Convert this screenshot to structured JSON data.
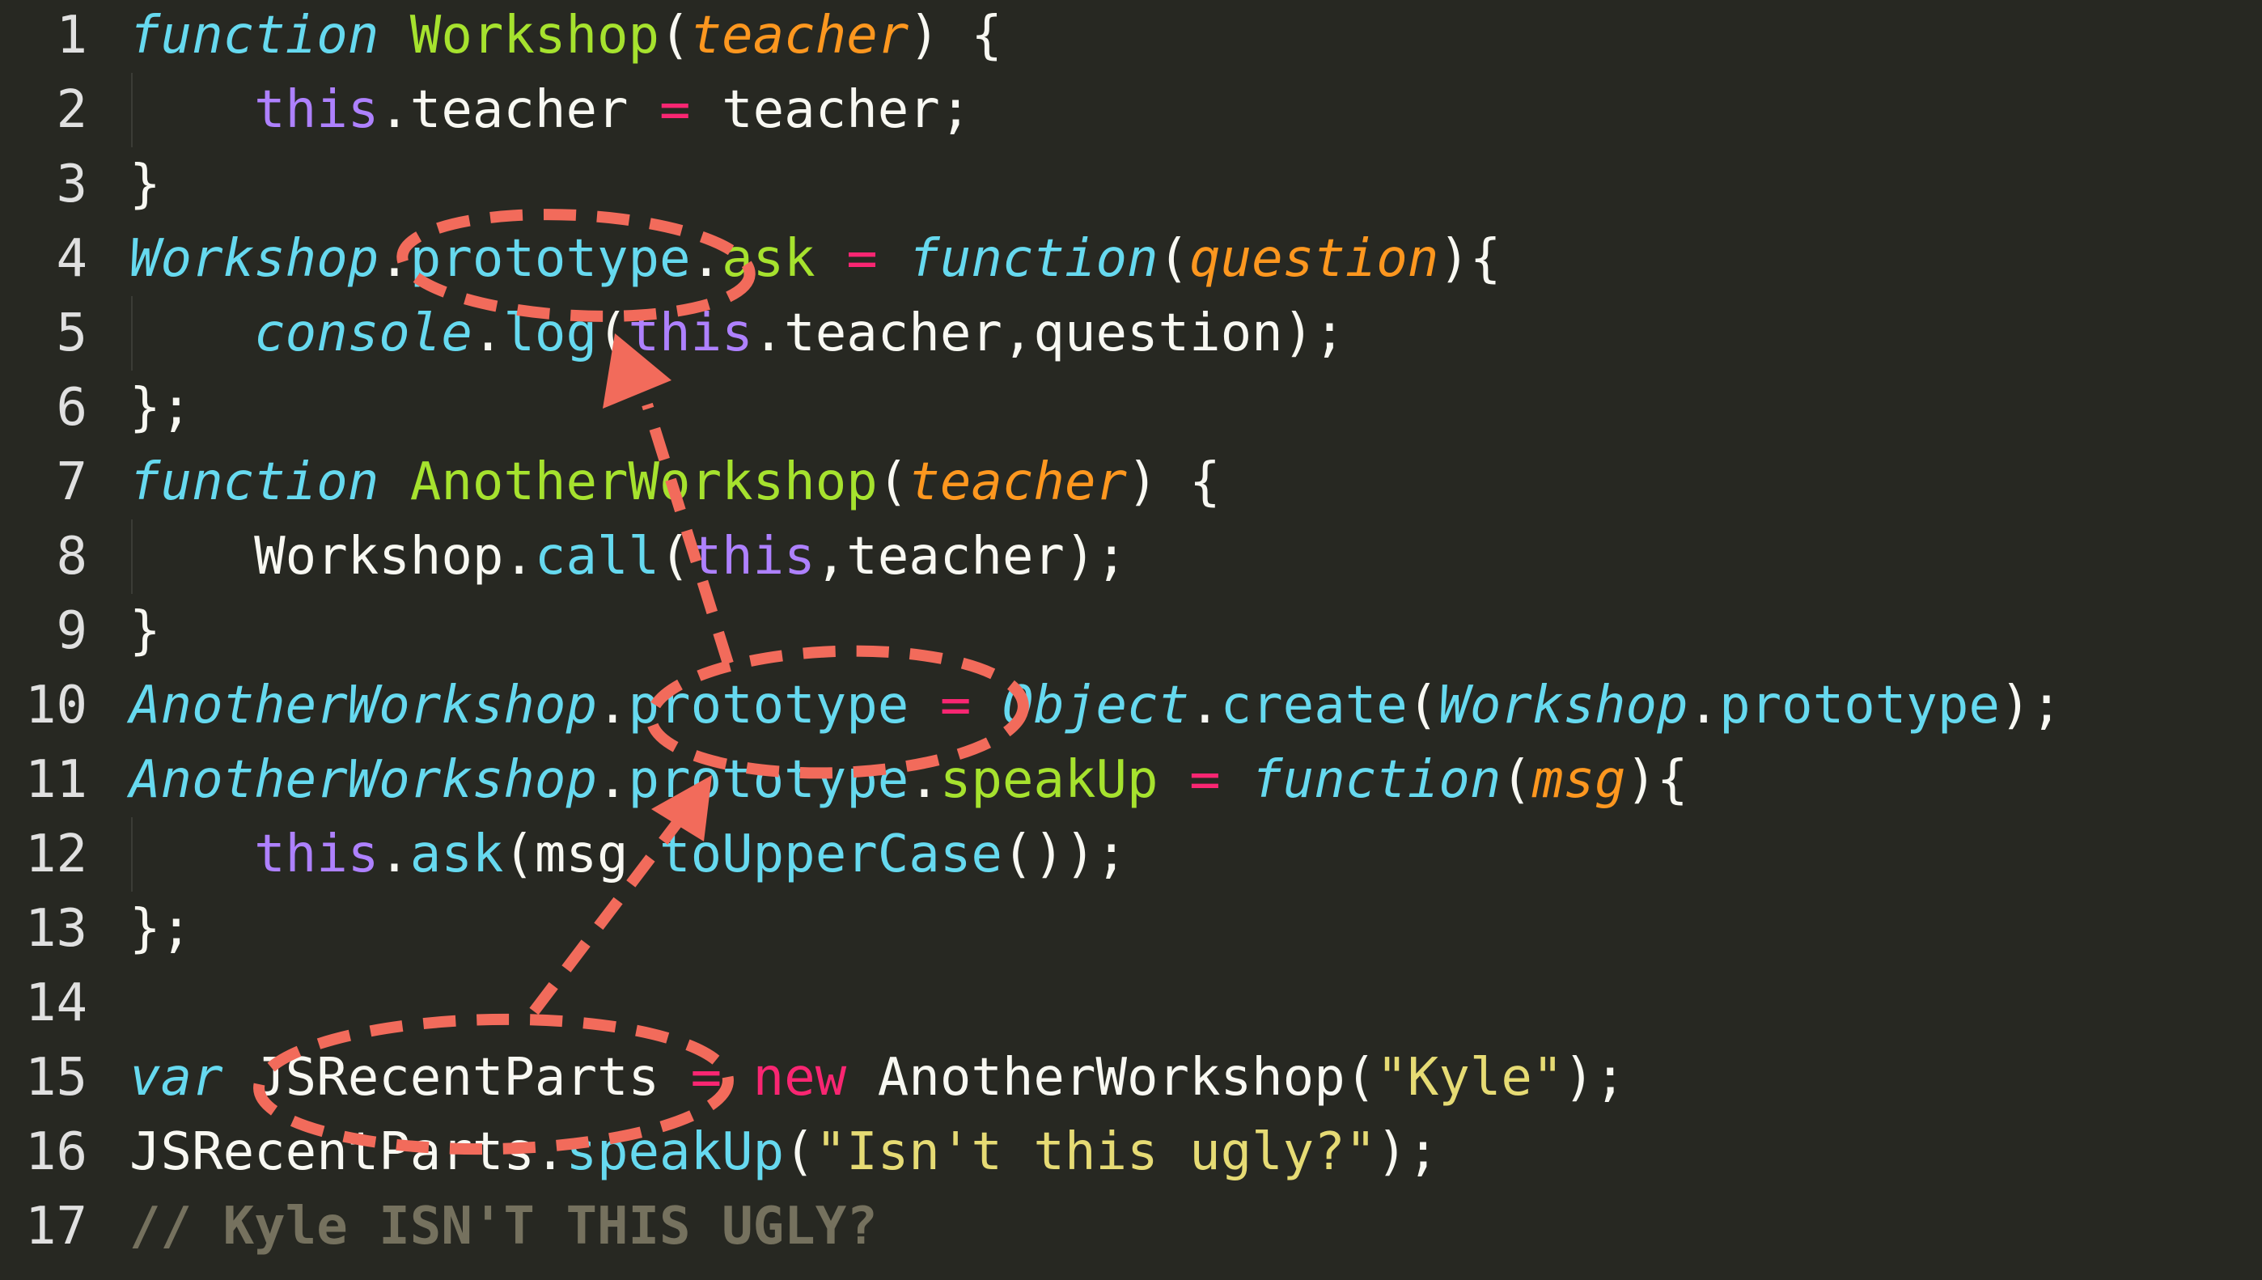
{
  "editor": {
    "lines": [
      {
        "num": "1",
        "tokens": [
          {
            "t": "function",
            "c": "kw"
          },
          {
            "t": " ",
            "c": "plain"
          },
          {
            "t": "Workshop",
            "c": "fn"
          },
          {
            "t": "(",
            "c": "plain"
          },
          {
            "t": "teacher",
            "c": "param"
          },
          {
            "t": ") {",
            "c": "plain"
          }
        ]
      },
      {
        "num": "2",
        "indent": true,
        "tokens": [
          {
            "t": "    ",
            "c": "plain"
          },
          {
            "t": "this",
            "c": "this"
          },
          {
            "t": ".teacher ",
            "c": "plain"
          },
          {
            "t": "=",
            "c": "op"
          },
          {
            "t": " teacher;",
            "c": "plain"
          }
        ]
      },
      {
        "num": "3",
        "tokens": [
          {
            "t": "}",
            "c": "plain"
          }
        ]
      },
      {
        "num": "4",
        "tokens": [
          {
            "t": "Workshop",
            "c": "cls"
          },
          {
            "t": ".",
            "c": "plain"
          },
          {
            "t": "prototype",
            "c": "method"
          },
          {
            "t": ".",
            "c": "plain"
          },
          {
            "t": "ask",
            "c": "prop"
          },
          {
            "t": " ",
            "c": "plain"
          },
          {
            "t": "=",
            "c": "op"
          },
          {
            "t": " ",
            "c": "plain"
          },
          {
            "t": "function",
            "c": "kw"
          },
          {
            "t": "(",
            "c": "plain"
          },
          {
            "t": "question",
            "c": "param"
          },
          {
            "t": "){",
            "c": "plain"
          }
        ]
      },
      {
        "num": "5",
        "indent": true,
        "tokens": [
          {
            "t": "    ",
            "c": "plain"
          },
          {
            "t": "console",
            "c": "cls"
          },
          {
            "t": ".",
            "c": "plain"
          },
          {
            "t": "log",
            "c": "method"
          },
          {
            "t": "(",
            "c": "plain"
          },
          {
            "t": "this",
            "c": "this"
          },
          {
            "t": ".teacher,question);",
            "c": "plain"
          }
        ]
      },
      {
        "num": "6",
        "tokens": [
          {
            "t": "};",
            "c": "plain"
          }
        ]
      },
      {
        "num": "7",
        "tokens": [
          {
            "t": "function",
            "c": "kw"
          },
          {
            "t": " ",
            "c": "plain"
          },
          {
            "t": "AnotherWorkshop",
            "c": "fn"
          },
          {
            "t": "(",
            "c": "plain"
          },
          {
            "t": "teacher",
            "c": "param"
          },
          {
            "t": ") {",
            "c": "plain"
          }
        ]
      },
      {
        "num": "8",
        "indent": true,
        "tokens": [
          {
            "t": "    Workshop.",
            "c": "plain"
          },
          {
            "t": "call",
            "c": "method"
          },
          {
            "t": "(",
            "c": "plain"
          },
          {
            "t": "this",
            "c": "this"
          },
          {
            "t": ",teacher);",
            "c": "plain"
          }
        ]
      },
      {
        "num": "9",
        "tokens": [
          {
            "t": "}",
            "c": "plain"
          }
        ]
      },
      {
        "num": "10",
        "tokens": [
          {
            "t": "AnotherWorkshop",
            "c": "cls"
          },
          {
            "t": ".",
            "c": "plain"
          },
          {
            "t": "prototype",
            "c": "method"
          },
          {
            "t": " ",
            "c": "plain"
          },
          {
            "t": "=",
            "c": "op"
          },
          {
            "t": " ",
            "c": "plain"
          },
          {
            "t": "Object",
            "c": "cls"
          },
          {
            "t": ".",
            "c": "plain"
          },
          {
            "t": "create",
            "c": "method"
          },
          {
            "t": "(",
            "c": "plain"
          },
          {
            "t": "Workshop",
            "c": "cls"
          },
          {
            "t": ".",
            "c": "plain"
          },
          {
            "t": "prototype",
            "c": "method"
          },
          {
            "t": ");",
            "c": "plain"
          }
        ]
      },
      {
        "num": "11",
        "tokens": [
          {
            "t": "AnotherWorkshop",
            "c": "cls"
          },
          {
            "t": ".",
            "c": "plain"
          },
          {
            "t": "prototype",
            "c": "method"
          },
          {
            "t": ".",
            "c": "plain"
          },
          {
            "t": "speakUp",
            "c": "prop"
          },
          {
            "t": " ",
            "c": "plain"
          },
          {
            "t": "=",
            "c": "op"
          },
          {
            "t": " ",
            "c": "plain"
          },
          {
            "t": "function",
            "c": "kw"
          },
          {
            "t": "(",
            "c": "plain"
          },
          {
            "t": "msg",
            "c": "param"
          },
          {
            "t": "){",
            "c": "plain"
          }
        ]
      },
      {
        "num": "12",
        "indent": true,
        "tokens": [
          {
            "t": "    ",
            "c": "plain"
          },
          {
            "t": "this",
            "c": "this"
          },
          {
            "t": ".",
            "c": "plain"
          },
          {
            "t": "ask",
            "c": "method"
          },
          {
            "t": "(msg.",
            "c": "plain"
          },
          {
            "t": "toUpperCase",
            "c": "method"
          },
          {
            "t": "());",
            "c": "plain"
          }
        ]
      },
      {
        "num": "13",
        "tokens": [
          {
            "t": "};",
            "c": "plain"
          }
        ]
      },
      {
        "num": "14",
        "tokens": []
      },
      {
        "num": "15",
        "tokens": [
          {
            "t": "var",
            "c": "kw"
          },
          {
            "t": " JSRecentParts ",
            "c": "plain"
          },
          {
            "t": "=",
            "c": "op"
          },
          {
            "t": " ",
            "c": "plain"
          },
          {
            "t": "new",
            "c": "op"
          },
          {
            "t": " AnotherWorkshop(",
            "c": "plain"
          },
          {
            "t": "\"Kyle\"",
            "c": "str"
          },
          {
            "t": ");",
            "c": "plain"
          }
        ]
      },
      {
        "num": "16",
        "tokens": [
          {
            "t": "JSRecentParts.",
            "c": "plain"
          },
          {
            "t": "speakUp",
            "c": "method"
          },
          {
            "t": "(",
            "c": "plain"
          },
          {
            "t": "\"Isn't this ugly?\"",
            "c": "str"
          },
          {
            "t": ");",
            "c": "plain"
          }
        ]
      },
      {
        "num": "17",
        "tokens": [
          {
            "t": "// Kyle ISN'T THIS UGLY?",
            "c": "comment"
          }
        ]
      }
    ]
  },
  "colors": {
    "background": "#272822",
    "annotation": "#f26b5b"
  }
}
